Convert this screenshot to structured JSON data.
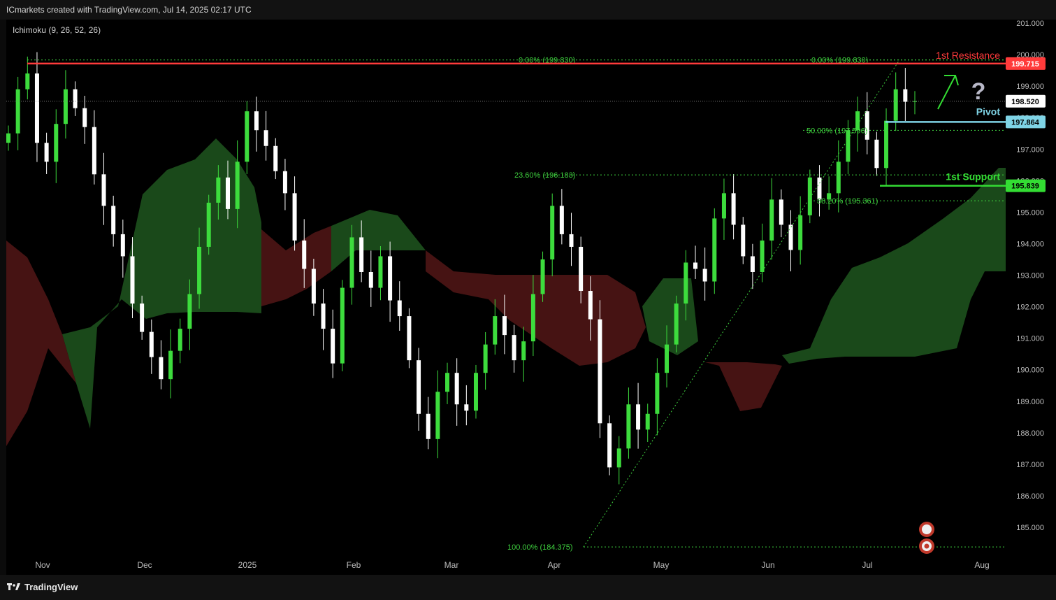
{
  "header": {
    "text": "ICmarkets created with TradingView.com, Jul 14, 2025 02:17 UTC"
  },
  "indicator": {
    "label": "Ichimoku (9, 26, 52, 26)"
  },
  "footer": {
    "brand": "TradingView"
  },
  "colors": {
    "background": "#000000",
    "bull_candle": "#3ddc3d",
    "bear_candle": "#ffffff",
    "cloud_bull": "#1b4d1b",
    "cloud_bear": "#4a1414",
    "resistance": "#ff3b3b",
    "pivot": "#7fd4e6",
    "support": "#33dd33",
    "fib": "#3ecf3e"
  },
  "chart_data": {
    "type": "candlestick",
    "y_axis": {
      "range": [
        184.0,
        201.3
      ],
      "ticks": [
        "201.000",
        "200.000",
        "199.000",
        "198.000",
        "197.000",
        "196.000",
        "195.000",
        "194.000",
        "193.000",
        "192.000",
        "191.000",
        "190.000",
        "189.000",
        "188.000",
        "187.000",
        "186.000",
        "185.000"
      ]
    },
    "x_axis": {
      "ticks": [
        "Nov",
        "Dec",
        "2025",
        "Feb",
        "Mar",
        "Apr",
        "May",
        "Jun",
        "Jul",
        "Aug"
      ]
    },
    "levels": [
      {
        "name": "1st Resistance",
        "value": 199.715,
        "label": "199.715",
        "color": "#ff3b3b"
      },
      {
        "name": "Pivot",
        "value": 197.864,
        "label": "197.864",
        "color": "#7fd4e6"
      },
      {
        "name": "1st Support",
        "value": 195.839,
        "label": "195.839",
        "color": "#33dd33"
      }
    ],
    "last_price": {
      "value": 198.52,
      "label": "198.520"
    },
    "fib_levels": [
      {
        "label": "0.00% (199.830)",
        "value": 199.83
      },
      {
        "label": "0.00% (199.830)",
        "value": 199.83
      },
      {
        "label": "50.00% (197.596)",
        "value": 197.596
      },
      {
        "label": "23.60% (196.183)",
        "value": 196.183
      },
      {
        "label": "38.20% (195.361)",
        "value": 195.361
      },
      {
        "label": "100.00% (184.375)",
        "value": 184.375
      }
    ],
    "annotations": [
      "?"
    ],
    "closes": [
      197.5,
      198.9,
      199.4,
      197.2,
      196.6,
      197.8,
      198.9,
      198.3,
      197.7,
      196.2,
      195.2,
      194.3,
      193.6,
      192.1,
      191.2,
      190.4,
      189.7,
      190.6,
      191.3,
      192.4,
      193.9,
      195.3,
      196.1,
      195.1,
      196.6,
      198.2,
      197.6,
      197.1,
      196.3,
      195.6,
      194.1,
      193.2,
      192.1,
      191.3,
      190.2,
      192.6,
      194.2,
      193.1,
      192.6,
      193.6,
      192.2,
      191.7,
      190.3,
      188.6,
      187.8,
      189.3,
      189.9,
      188.9,
      188.7,
      189.9,
      190.8,
      191.7,
      191.1,
      190.3,
      190.9,
      192.4,
      193.5,
      195.2,
      194.3,
      193.9,
      192.5,
      191.6,
      188.3,
      186.9,
      187.5,
      188.9,
      188.1,
      188.6,
      189.9,
      190.8,
      192.1,
      193.4,
      193.2,
      192.8,
      194.8,
      195.6,
      194.6,
      193.6,
      193.1,
      194.1,
      195.4,
      194.6,
      193.8,
      194.9,
      196.1,
      195.4,
      195.6,
      196.6,
      197.6,
      198.2,
      197.3,
      196.4,
      197.9,
      198.9,
      198.5,
      198.52
    ]
  }
}
